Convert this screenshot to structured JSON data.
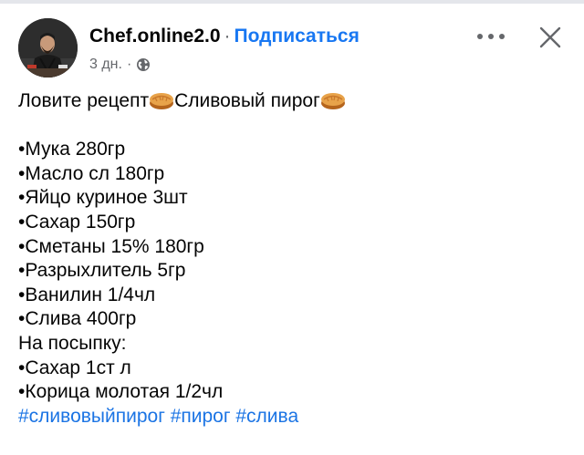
{
  "post": {
    "author_name": "Chef.online2.0",
    "separator": "·",
    "subscribe_label": "Подписаться",
    "timestamp": "3 дн.",
    "meta_separator": "·",
    "audience_icon": "globe-icon"
  },
  "header_actions": {
    "more_icon": "more-horizontal-icon",
    "close_icon": "close-icon"
  },
  "body": {
    "intro_part1": "Ловите рецепт",
    "intro_part2": "Сливовый пирог",
    "emoji_icon": "pie-icon",
    "ingredients": [
      "•Мука 280гр",
      "•Масло сл 180гр",
      "•Яйцо куриное 3шт",
      "•Сахар 150гр",
      "•Сметаны 15% 180гр",
      "•Разрыхлитель 5гр",
      "•Ванилин 1/4чл",
      "•Слива 400гр"
    ],
    "topping_heading": "На посыпку:",
    "topping_items": [
      "•Сахар 1ст л",
      "•Корица молотая 1/2чл"
    ],
    "hashtags": [
      "#сливовыйпирог",
      "#пирог",
      "#слива"
    ]
  },
  "colors": {
    "link_blue": "#1877f2",
    "hashtag_blue": "#1b74e4",
    "secondary_text": "#65676b",
    "primary_text": "#050505"
  }
}
